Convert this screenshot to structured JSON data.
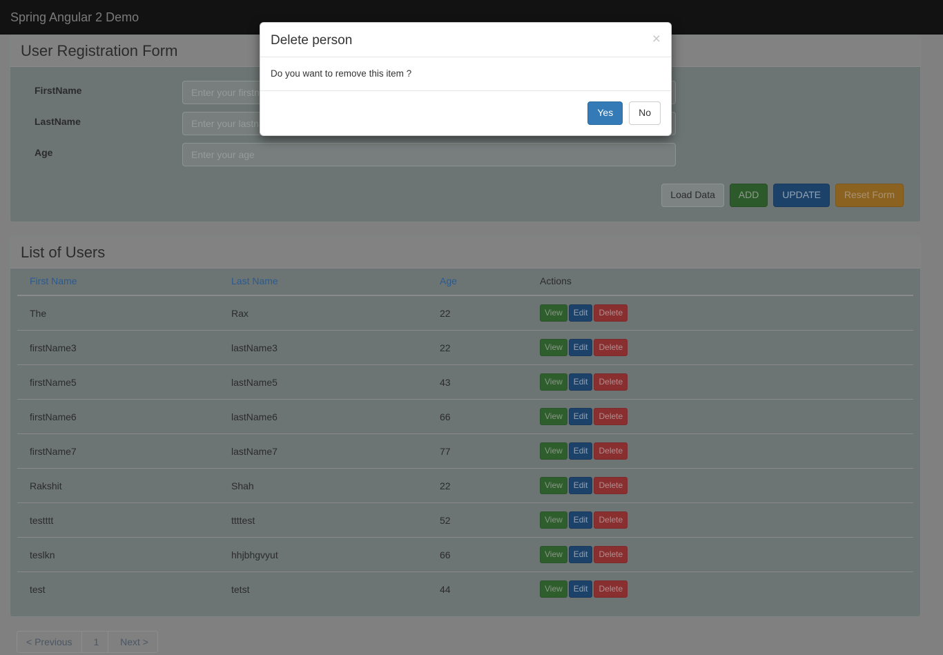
{
  "navbar": {
    "brand": "Spring Angular 2 Demo"
  },
  "form_panel": {
    "title": "User Registration Form",
    "fields": [
      {
        "label": "FirstName",
        "placeholder": "Enter your firstname",
        "value": ""
      },
      {
        "label": "LastName",
        "placeholder": "Enter your lastname. ",
        "value": ""
      },
      {
        "label": "Age",
        "placeholder": "Enter your age",
        "value": ""
      }
    ],
    "buttons": [
      {
        "label": "Load Data",
        "style": "default"
      },
      {
        "label": "ADD",
        "style": "success"
      },
      {
        "label": "UPDATE",
        "style": "primary"
      },
      {
        "label": "Reset Form",
        "style": "warning"
      }
    ]
  },
  "list_panel": {
    "title": "List of Users",
    "columns": [
      {
        "label": "First Name",
        "sortable": true
      },
      {
        "label": "Last Name",
        "sortable": true
      },
      {
        "label": "Age",
        "sortable": true
      },
      {
        "label": "Actions",
        "sortable": false
      }
    ],
    "row_actions": [
      {
        "label": "View",
        "style": "view"
      },
      {
        "label": "Edit",
        "style": "edit"
      },
      {
        "label": "Delete",
        "style": "delete"
      }
    ],
    "rows": [
      {
        "first_name": "The",
        "last_name": "Rax",
        "age": "22"
      },
      {
        "first_name": "firstName3",
        "last_name": "lastName3",
        "age": "22"
      },
      {
        "first_name": "firstName5",
        "last_name": "lastName5",
        "age": "43"
      },
      {
        "first_name": "firstName6",
        "last_name": "lastName6",
        "age": "66"
      },
      {
        "first_name": "firstName7",
        "last_name": "lastName7",
        "age": "77"
      },
      {
        "first_name": "Rakshit",
        "last_name": "Shah",
        "age": "22"
      },
      {
        "first_name": "testttt",
        "last_name": "ttttest",
        "age": "52"
      },
      {
        "first_name": "teslkn",
        "last_name": "hhjbhgvyut",
        "age": "66"
      },
      {
        "first_name": "test",
        "last_name": "tetst",
        "age": "44"
      }
    ]
  },
  "pagination": {
    "previous": "< Previous",
    "pages": [
      "1"
    ],
    "next": "Next >"
  },
  "modal": {
    "title": "Delete person",
    "close_icon": "×",
    "body": "Do you want to remove this item ?",
    "confirm_label": "Yes",
    "cancel_label": "No"
  },
  "colors": {
    "navbar_bg": "#121212",
    "accent_blue": "#337ab7",
    "link_blue": "#2a5a8f",
    "success_green": "#2f5e2d",
    "danger_red": "#8a2f30",
    "warning_orange": "#8b6220",
    "backdrop": "#808080"
  }
}
